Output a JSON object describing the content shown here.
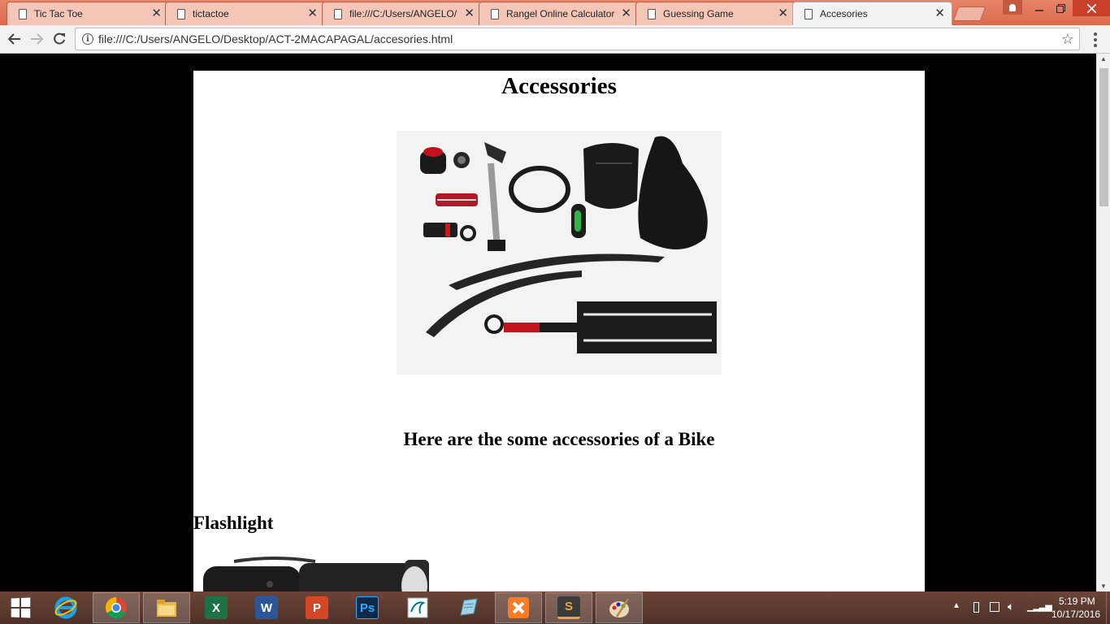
{
  "browser": {
    "tabs": [
      {
        "label": "Tic Tac Toe",
        "active": false
      },
      {
        "label": "tictactoe",
        "active": false
      },
      {
        "label": "file:///C:/Users/ANGELO/",
        "active": false
      },
      {
        "label": "Rangel Online Calculator",
        "active": false
      },
      {
        "label": "Guessing Game",
        "active": false
      },
      {
        "label": "Accesories",
        "active": true
      }
    ],
    "close_glyph": "✕",
    "url": "file:///C:/Users/ANGELO/Desktop/ACT-2MACAPAGAL/accesories.html",
    "accent_color": "#e3765b"
  },
  "page": {
    "title": "Accessories",
    "intro": "Here are the some accessories of a Bike",
    "section_heading": "Flashlight"
  },
  "taskbar": {
    "apps": [
      {
        "name": "internet-explorer-icon"
      },
      {
        "name": "chrome-icon"
      },
      {
        "name": "file-explorer-icon"
      },
      {
        "name": "excel-icon",
        "letter": "X"
      },
      {
        "name": "word-icon",
        "letter": "W"
      },
      {
        "name": "powerpoint-icon",
        "letter": "P"
      },
      {
        "name": "photoshop-icon",
        "letter": "Ps"
      },
      {
        "name": "mysql-installer-icon"
      },
      {
        "name": "notepad-icon"
      },
      {
        "name": "xampp-icon"
      },
      {
        "name": "sublime-text-icon",
        "letter": "S"
      },
      {
        "name": "paint-icon"
      }
    ],
    "clock": {
      "time": "5:19 PM",
      "date": "10/17/2016"
    }
  }
}
